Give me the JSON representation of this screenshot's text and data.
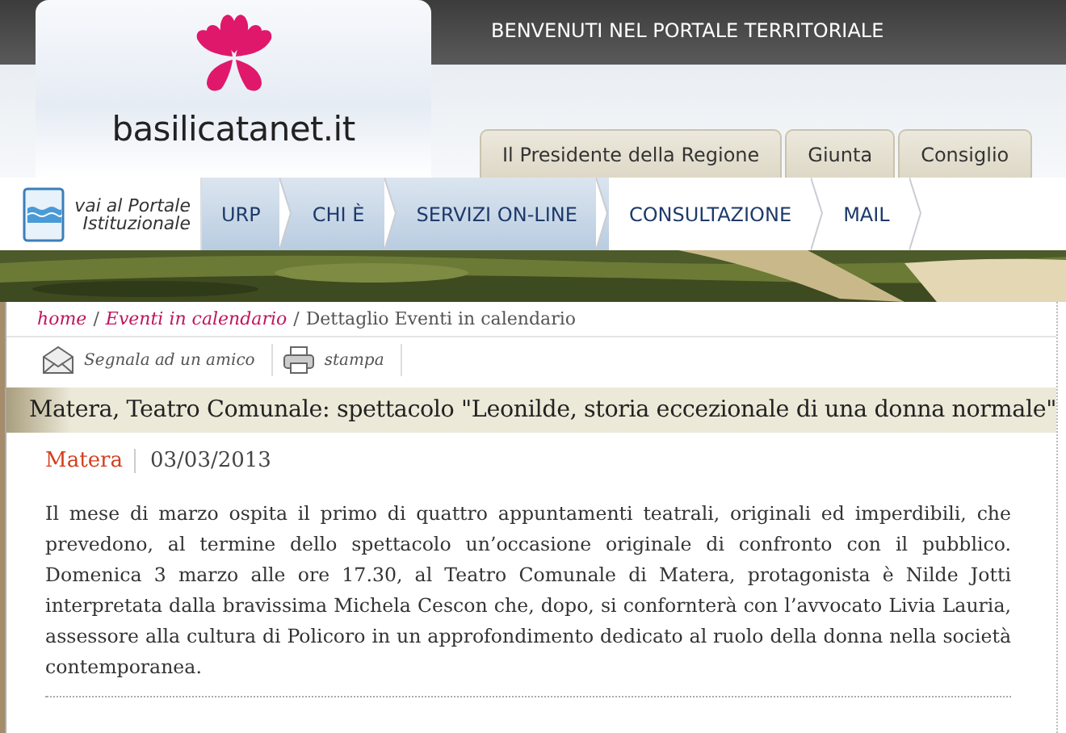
{
  "header": {
    "site_name": "basilicatanet.it",
    "welcome": "BENVENUTI NEL PORTALE TERRITORIALE",
    "tabs": [
      {
        "label": "Il Presidente della Regione"
      },
      {
        "label": "Giunta"
      },
      {
        "label": "Consiglio"
      }
    ]
  },
  "nav": {
    "portal_link": "vai al Portale Istituzionale",
    "items": [
      {
        "label": "URP",
        "highlighted": true
      },
      {
        "label": "CHI È",
        "highlighted": true
      },
      {
        "label": "SERVIZI ON-LINE",
        "highlighted": true
      },
      {
        "label": "CONSULTAZIONE",
        "highlighted": false
      },
      {
        "label": "MAIL",
        "highlighted": false
      }
    ]
  },
  "breadcrumb": {
    "separator": "/",
    "items": [
      {
        "label": "home",
        "link": true
      },
      {
        "label": "Eventi in calendario",
        "link": true
      },
      {
        "label": "Dettaglio Eventi in calendario",
        "link": false
      }
    ]
  },
  "tools": [
    {
      "kind": "mail",
      "label": "Segnala ad un amico"
    },
    {
      "kind": "print",
      "label": "stampa"
    }
  ],
  "article": {
    "title": "Matera, Teatro Comunale: spettacolo \"Leonilde, storia eccezionale di una donna normale\"",
    "place": "Matera",
    "date": "03/03/2013",
    "body": "Il mese di marzo ospita il primo di quattro appuntamenti teatrali, originali ed imperdibili, che prevedono, al termine dello spettacolo un’occasione originale di confronto con il pubblico. Domenica 3 marzo alle ore 17.30, al Teatro Comunale di Matera, protagonista è Nilde Jotti interpretata dalla bravissima Michela Cescon che, dopo, si confornterà con l’avvocato Livia Lauria, assessore alla cultura di Policoro in un approfondimento dedicato al ruolo della donna nella società contemporanea."
  }
}
